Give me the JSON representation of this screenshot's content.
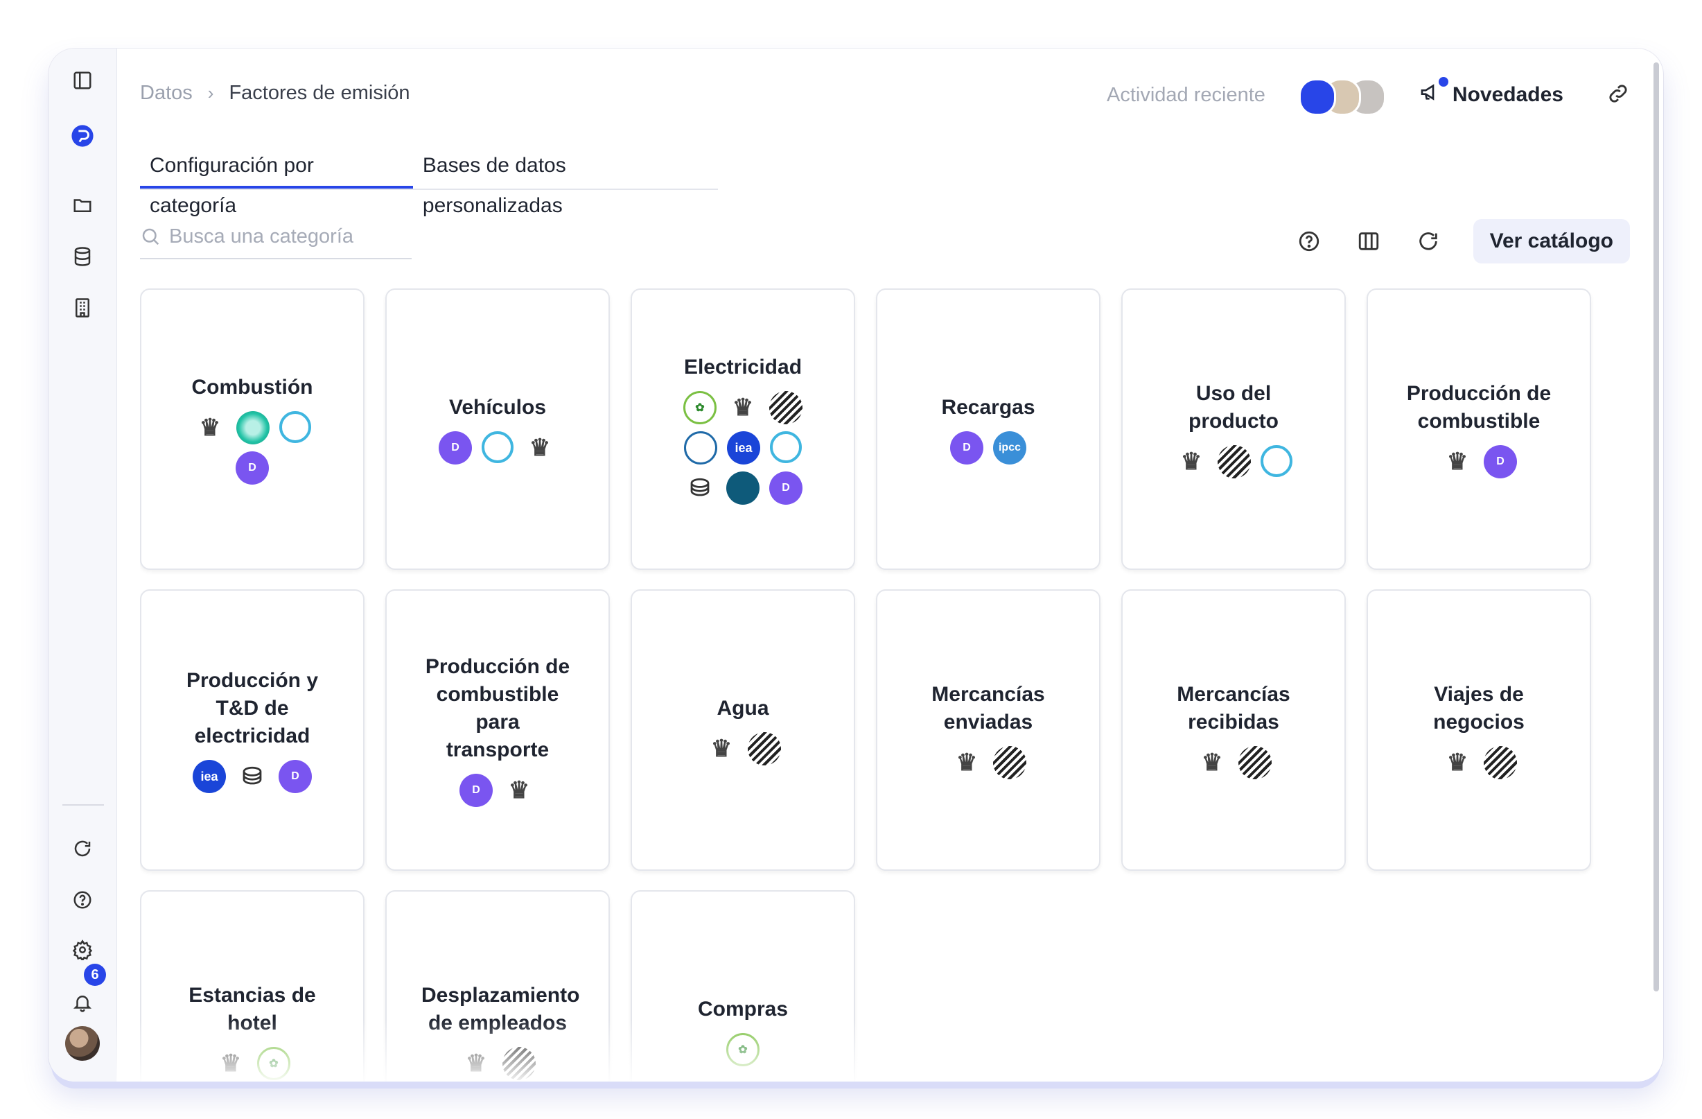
{
  "breadcrumb": {
    "parent": "Datos",
    "separator": "›",
    "current": "Factores de emisión"
  },
  "header": {
    "recent_activity": "Actividad reciente",
    "news_label": "Novedades"
  },
  "tabs": [
    {
      "label": "Configuración por categoría",
      "active": true
    },
    {
      "label": "Bases de datos personalizadas",
      "active": false
    }
  ],
  "search": {
    "placeholder": "Busca una categoría",
    "value": ""
  },
  "toolbar": {
    "catalog_label": "Ver catálogo"
  },
  "sidebar": {
    "notifications_count": "6"
  },
  "colors": {
    "accent": "#2845e8",
    "brand_purple": "#7a55f0"
  },
  "logo_glyphs": {
    "dcycle": "D",
    "iea": "iea",
    "ipcc": "ipcc",
    "defra": "♛",
    "db": "⛁",
    "green": "✿"
  },
  "cards": [
    {
      "title": "Combustión",
      "logos": [
        "defra-icon",
        "teal-icon",
        "ring-icon",
        "dcycle-icon"
      ]
    },
    {
      "title": "Vehículos",
      "logos": [
        "dcycle-icon",
        "ring-icon",
        "defra-icon"
      ]
    },
    {
      "title": "Electricidad",
      "logos": [
        "green-icon",
        "defra-icon",
        "stripe-icon",
        "epa-icon",
        "iea-icon",
        "ring-icon",
        "db-icon",
        "fan-icon",
        "dcycle-icon"
      ]
    },
    {
      "title": "Recargas",
      "logos": [
        "dcycle-icon",
        "ipcc-icon"
      ]
    },
    {
      "title": "Uso del producto",
      "logos": [
        "defra-icon",
        "stripe-icon",
        "ring-icon"
      ]
    },
    {
      "title": "Producción de combustible",
      "logos": [
        "defra-icon",
        "dcycle-icon"
      ]
    },
    {
      "title": "Producción y T&D de electricidad",
      "logos": [
        "iea-icon",
        "db-icon",
        "dcycle-icon"
      ]
    },
    {
      "title": "Producción de combustible para transporte",
      "logos": [
        "dcycle-icon",
        "defra-icon"
      ]
    },
    {
      "title": "Agua",
      "logos": [
        "defra-icon",
        "stripe-icon"
      ]
    },
    {
      "title": "Mercancías enviadas",
      "logos": [
        "defra-icon",
        "stripe-icon"
      ]
    },
    {
      "title": "Mercancías recibidas",
      "logos": [
        "defra-icon",
        "stripe-icon"
      ]
    },
    {
      "title": "Viajes de negocios",
      "logos": [
        "defra-icon",
        "stripe-icon"
      ]
    },
    {
      "title": "Estancias de hotel",
      "logos": [
        "defra-icon",
        "green-icon"
      ]
    },
    {
      "title": "Desplazamiento de empleados",
      "logos": [
        "defra-icon",
        "stripe-icon"
      ]
    },
    {
      "title": "Compras",
      "logos": [
        "green-icon"
      ]
    }
  ]
}
